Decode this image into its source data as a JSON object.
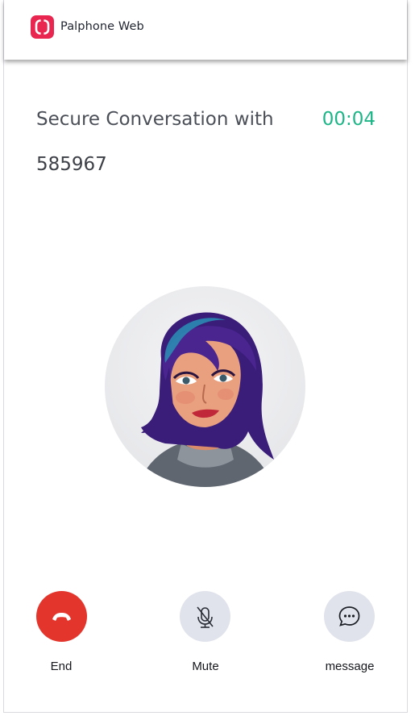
{
  "app": {
    "name": "Palphone Web",
    "brand_color": "#e8264f"
  },
  "call": {
    "title": "Secure Conversation with",
    "timer": "00:04",
    "timer_color": "#1cb686",
    "contact_number": "585967"
  },
  "avatar": {
    "description_icon": "user-avatar"
  },
  "controls": {
    "end": {
      "label": "End",
      "icon": "phone-hangup-icon",
      "color": "#e3352c"
    },
    "mute": {
      "label": "Mute",
      "icon": "mic-off-icon",
      "color": "#e1e3ec"
    },
    "message": {
      "label": "message",
      "icon": "chat-bubble-icon",
      "color": "#e1e3ec"
    }
  }
}
